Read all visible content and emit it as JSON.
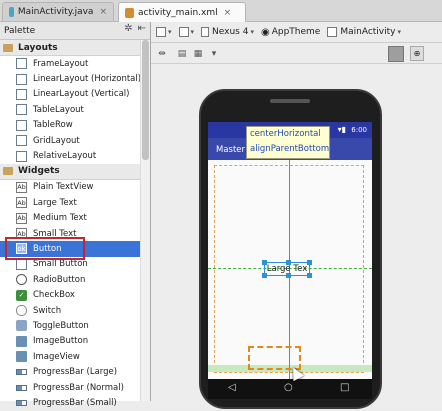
{
  "tabs": [
    {
      "label": "MainActivity.java",
      "icon": "java-file-icon",
      "color": "#4aa5c2"
    },
    {
      "label": "activity_main.xml",
      "icon": "xml-file-icon",
      "color": "#d58a34"
    }
  ],
  "palette": {
    "title": "Palette",
    "categories": [
      {
        "label": "Layouts",
        "items": [
          "FrameLayout",
          "LinearLayout (Horizontal)",
          "LinearLayout (Vertical)",
          "TableLayout",
          "TableRow",
          "GridLayout",
          "RelativeLayout"
        ]
      },
      {
        "label": "Widgets",
        "items": [
          "Plain TextView",
          "Large Text",
          "Medium Text",
          "Small Text",
          "Button",
          "Small Button",
          "RadioButton",
          "CheckBox",
          "Switch",
          "ToggleButton",
          "ImageButton",
          "ImageView",
          "ProgressBar (Large)",
          "ProgressBar (Normal)",
          "ProgressBar (Small)"
        ]
      }
    ],
    "selected_item": "Button"
  },
  "toolbar": {
    "device": "Nexus 4",
    "theme": "AppTheme",
    "activity": "MainActivity"
  },
  "preview": {
    "status_time": "6:00",
    "action_bar_title": "Master C",
    "tooltip_line1": "centerHorizontal",
    "tooltip_line2": "alignParentBottom",
    "widget_text": "Large Tex",
    "accent_color": "#3949ab",
    "guide_color": "#3db33d",
    "selection_color": "#2b91d8"
  }
}
